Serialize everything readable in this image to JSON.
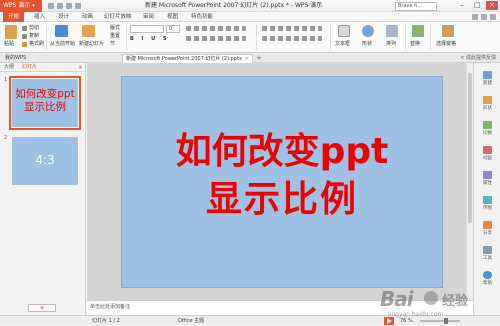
{
  "app": {
    "logo_label": "WPS 演示",
    "window_title": "新建 Microsoft PowerPoint 2007 幻灯片 (2).pptx * - WPS 演示",
    "account_label": "Brave h..."
  },
  "menu": {
    "tabs": [
      "开始",
      "插入",
      "设计",
      "动画",
      "幻灯片放映",
      "审阅",
      "视图",
      "特色功能"
    ],
    "active": "开始"
  },
  "ribbon": {
    "paste": "粘贴",
    "cut": "剪切",
    "copy": "复制",
    "format_painter": "格式刷",
    "from_current": "从当前开始",
    "new_slide": "新建幻灯片",
    "layout": "版式",
    "reset": "重置",
    "section": "节",
    "font_size": "0",
    "text_box": "文本框",
    "shape": "形状",
    "arrange": "排列",
    "replace": "替换",
    "select_pane": "选择窗格"
  },
  "doc_tabs": {
    "tab1": "我的WPS",
    "tab2": "新建 Microsoft PowerPoint 2007 幻灯片 (2).pptx",
    "plus": "+",
    "right_label": "< 成此提供反馈"
  },
  "panel": {
    "tab_outline": "大纲",
    "tab_slides": "幻灯片",
    "close": "×",
    "slides": [
      {
        "num": "1",
        "text": "如何改变ppt显示比例"
      },
      {
        "num": "2",
        "text": "4:3"
      }
    ],
    "add": "+"
  },
  "slide": {
    "line1": "如何改变ppt",
    "line2": "显示比例"
  },
  "notes": {
    "placeholder": "单击此处添加备注"
  },
  "sidebar": {
    "items": [
      "新建",
      "形状",
      "切换",
      "动画",
      "属性",
      "传图",
      "分享",
      "工具",
      "帮助"
    ]
  },
  "status": {
    "slide_count": "幻灯片 1 / 2",
    "theme": "Office 主题",
    "zoom": "76 %"
  },
  "watermark": {
    "logo": "Bai",
    "brand": "经验",
    "url": "jingyan.baidu.com"
  },
  "colors": {
    "accent": "#e8542e",
    "slide_bg": "#9fc1e4",
    "title_red": "#ee0000"
  }
}
